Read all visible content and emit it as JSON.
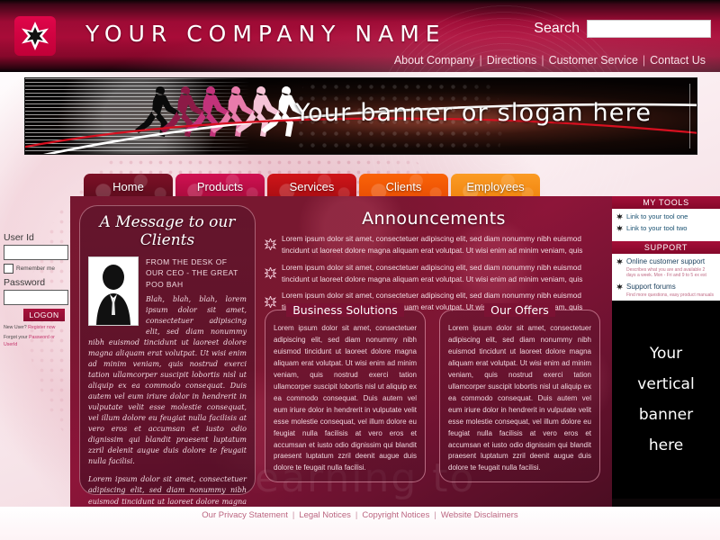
{
  "header": {
    "logo_icon": "star-burst-logo",
    "company_name": "YOUR COMPANY NAME",
    "search_label": "Search",
    "search_value": "",
    "search_placeholder": "",
    "topnav": [
      {
        "label": "About Company"
      },
      {
        "label": "Directions"
      },
      {
        "label": "Customer Service"
      },
      {
        "label": "Contact Us"
      }
    ],
    "separator": "|"
  },
  "banner": {
    "text": "Your banner or slogan here",
    "runners_icon": "running-figures-silhouette"
  },
  "tabs": [
    {
      "label": "Home",
      "color": "#6b0f24"
    },
    {
      "label": "Products",
      "color": "#c20b4c"
    },
    {
      "label": "Services",
      "color": "#c41216"
    },
    {
      "label": "Clients",
      "color": "#f25a06"
    },
    {
      "label": "Employees",
      "color": "#f79420"
    }
  ],
  "login": {
    "user_id_label": "User Id",
    "user_id_value": "",
    "remember_label": "Remember me",
    "remember_checked": false,
    "password_label": "Password",
    "password_value": "",
    "logon_label": "LOGON",
    "new_user_text": "New User?",
    "new_user_link": "Register now",
    "forgot_text": "Forgot your",
    "forgot_link": "Password or UserId"
  },
  "message_panel": {
    "title": "A Message to our Clients",
    "photo_icon": "ceo-portrait-silhouette",
    "desk_line": "FROM THE DESK OF OUR CEO - THE GREAT POO BAH",
    "body": "Blah, blah, blah, lorem ipsum dolor sit amet, consectetuer adipiscing elit, sed diam nonummy nibh euismod tincidunt ut laoreet dolore magna aliquam erat volutpat. Ut wisi enim ad minim veniam, quis nostrud exerci tation ullamcorper suscipit lobortis nisl ut aliquip ex ea commodo consequat. Duis autem vel eum iriure dolor in hendrerit in vulputate velit esse molestie consequat, vel illum dolore eu feugiat nulla facilisis at vero eros et accumsan et iusto odio dignissim qui blandit praesent luptatum zzril delenit augue duis dolore te feugait nulla facilisi.",
    "body2": "Lorem ipsum dolor sit amet, consectetuer adipiscing elit, sed diam nonummy nibh euismod tincidunt ut laoreet dolore magna aliquam erat volutpat."
  },
  "announcements": {
    "title": "Announcements",
    "bullet_icon": "flower-star-bullet",
    "items": [
      {
        "text": "Lorem ipsum dolor sit amet, consectetuer adipiscing elit, sed diam nonummy nibh euismod tincidunt ut laoreet dolore magna aliquam erat volutpat. Ut wisi enim ad minim veniam, quis"
      },
      {
        "text": "Lorem ipsum dolor sit amet, consectetuer adipiscing elit, sed diam nonummy nibh euismod tincidunt ut laoreet dolore magna aliquam erat volutpat. Ut wisi enim ad minim veniam, quis"
      },
      {
        "text": "Lorem ipsum dolor sit amet, consectetuer adipiscing elit, sed diam nonummy nibh euismod tincidunt ut laoreet dolore magna aliquam erat volutpat. Ut wisi enim ad minim veniam, quis"
      }
    ],
    "watermark": "earning to"
  },
  "panels": {
    "solutions_title": "Business Solutions",
    "solutions_body": "Lorem ipsum dolor sit amet, consectetuer adipiscing elit, sed diam nonummy nibh euismod tincidunt ut laoreet dolore magna aliquam erat volutpat. Ut wisi enim ad minim veniam, quis nostrud exerci tation ullamcorper suscipit lobortis nisl ut aliquip ex ea commodo consequat. Duis autem vel eum iriure dolor in hendrerit in vulputate velit esse molestie consequat, vel illum dolore eu feugiat nulla facilisis at vero eros et accumsan et iusto odio dignissim qui blandit praesent luptatum zzril deenit augue duis dolore te feugait nulla facilisi.",
    "offers_title": "Our Offers",
    "offers_body": "Lorem ipsum dolor sit amet, consectetuer adipiscing elit, sed diam nonummy nibh euismod tincidunt ut laoreet dolore magna aliquam erat volutpat. Ut wisi enim ad minim veniam, quis nostrud exerci tation ullamcorper suscipit lobortis nisl ut aliquip ex ea commodo consequat. Duis autem vel eum iriure dolor in hendrerit in vulputate velit esse molestie consequat, vel illum dolore eu feugiat nulla facilisis at vero eros et accumsan et iusto odio dignissim qui blandit praesent luptatum zzril deenit augue duis dolore te feugait nulla facilisi."
  },
  "right_sidebar": {
    "tools_header": "MY TOOLS",
    "tools": [
      {
        "label": "Link to your tool one"
      },
      {
        "label": "Link to your tool two"
      }
    ],
    "support_header": "SUPPORT",
    "support": [
      {
        "label": "Online customer support",
        "sub": "Describes what you are and available 2 days a week. Mon - Fri and 9 to 5 ex est"
      },
      {
        "label": "Support forums",
        "sub": "Find more questions, easy product manuals"
      }
    ],
    "bullet_icon": "arrow-star-bullet",
    "vertical_banner": [
      "Your",
      "vertical",
      "banner",
      "here"
    ]
  },
  "footer": {
    "links": [
      {
        "label": "Our Privacy Statement"
      },
      {
        "label": "Legal Notices"
      },
      {
        "label": "Copyright Notices"
      },
      {
        "label": "Website Disclaimers"
      }
    ],
    "separator": "|"
  },
  "colors": {
    "brand_crimson": "#a50f38",
    "panel_maroon": "#7b1233",
    "accent_orange": "#f79420",
    "banner_black": "#000000"
  }
}
